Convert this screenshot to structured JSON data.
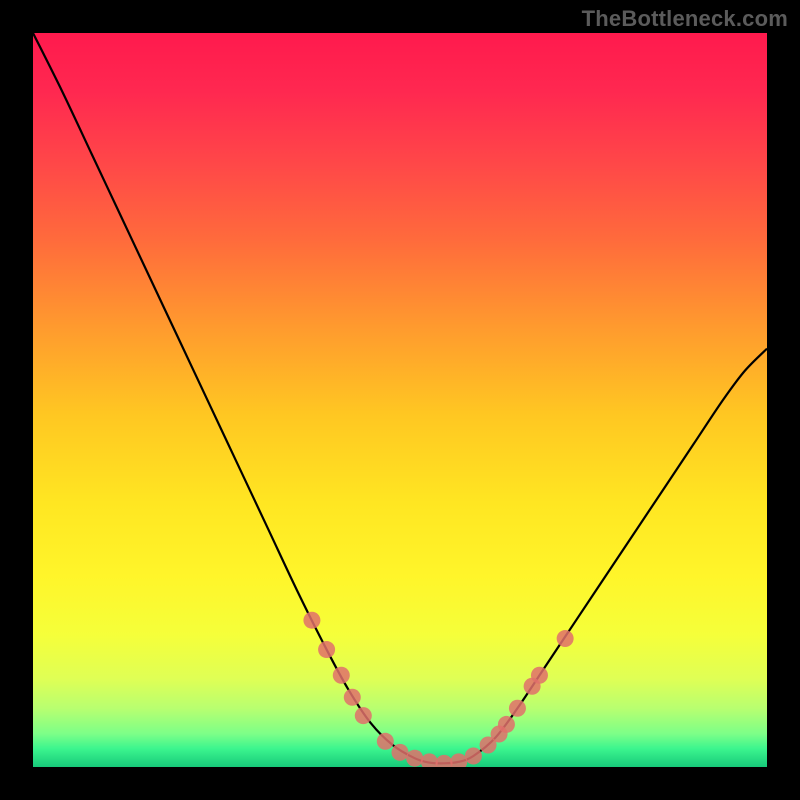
{
  "watermark": "TheBottleneck.com",
  "chart_data": {
    "type": "line",
    "title": "",
    "xlabel": "",
    "ylabel": "",
    "xlim": [
      0,
      100
    ],
    "ylim": [
      0,
      100
    ],
    "x": [
      0,
      4,
      8,
      12,
      16,
      20,
      24,
      28,
      32,
      36,
      40,
      43,
      46,
      49,
      52,
      54,
      56,
      58,
      60,
      63,
      66,
      70,
      74,
      78,
      82,
      86,
      90,
      94,
      97,
      100
    ],
    "values": [
      100,
      92,
      83.5,
      75,
      66.5,
      58,
      49.5,
      41,
      32.5,
      24,
      16,
      10.5,
      6,
      3,
      1.2,
      0.6,
      0.5,
      0.7,
      1.5,
      4,
      8,
      14,
      20,
      26,
      32,
      38,
      44,
      50,
      54,
      57
    ],
    "curve_color": "#000000",
    "bead_color": "#e0706b",
    "beads": [
      {
        "x": 38,
        "y": 20
      },
      {
        "x": 40,
        "y": 16
      },
      {
        "x": 42,
        "y": 12.5
      },
      {
        "x": 43.5,
        "y": 9.5
      },
      {
        "x": 45,
        "y": 7
      },
      {
        "x": 48,
        "y": 3.5
      },
      {
        "x": 50,
        "y": 2
      },
      {
        "x": 52,
        "y": 1.2
      },
      {
        "x": 54,
        "y": 0.7
      },
      {
        "x": 56,
        "y": 0.5
      },
      {
        "x": 58,
        "y": 0.7
      },
      {
        "x": 60,
        "y": 1.5
      },
      {
        "x": 62,
        "y": 3
      },
      {
        "x": 63.5,
        "y": 4.5
      },
      {
        "x": 64.5,
        "y": 5.8
      },
      {
        "x": 66,
        "y": 8
      },
      {
        "x": 68,
        "y": 11
      },
      {
        "x": 69,
        "y": 12.5
      },
      {
        "x": 72.5,
        "y": 17.5
      }
    ],
    "gradient_stops": [
      {
        "offset": 0.0,
        "color": "#ff1a4d"
      },
      {
        "offset": 0.08,
        "color": "#ff2850"
      },
      {
        "offset": 0.18,
        "color": "#ff4848"
      },
      {
        "offset": 0.28,
        "color": "#ff6a3c"
      },
      {
        "offset": 0.4,
        "color": "#ff9a2e"
      },
      {
        "offset": 0.52,
        "color": "#ffc722"
      },
      {
        "offset": 0.64,
        "color": "#ffe622"
      },
      {
        "offset": 0.74,
        "color": "#fff52a"
      },
      {
        "offset": 0.82,
        "color": "#f5ff3a"
      },
      {
        "offset": 0.88,
        "color": "#dfff55"
      },
      {
        "offset": 0.92,
        "color": "#b8ff70"
      },
      {
        "offset": 0.955,
        "color": "#7cff88"
      },
      {
        "offset": 0.975,
        "color": "#3cf58e"
      },
      {
        "offset": 1.0,
        "color": "#17c97a"
      }
    ]
  }
}
